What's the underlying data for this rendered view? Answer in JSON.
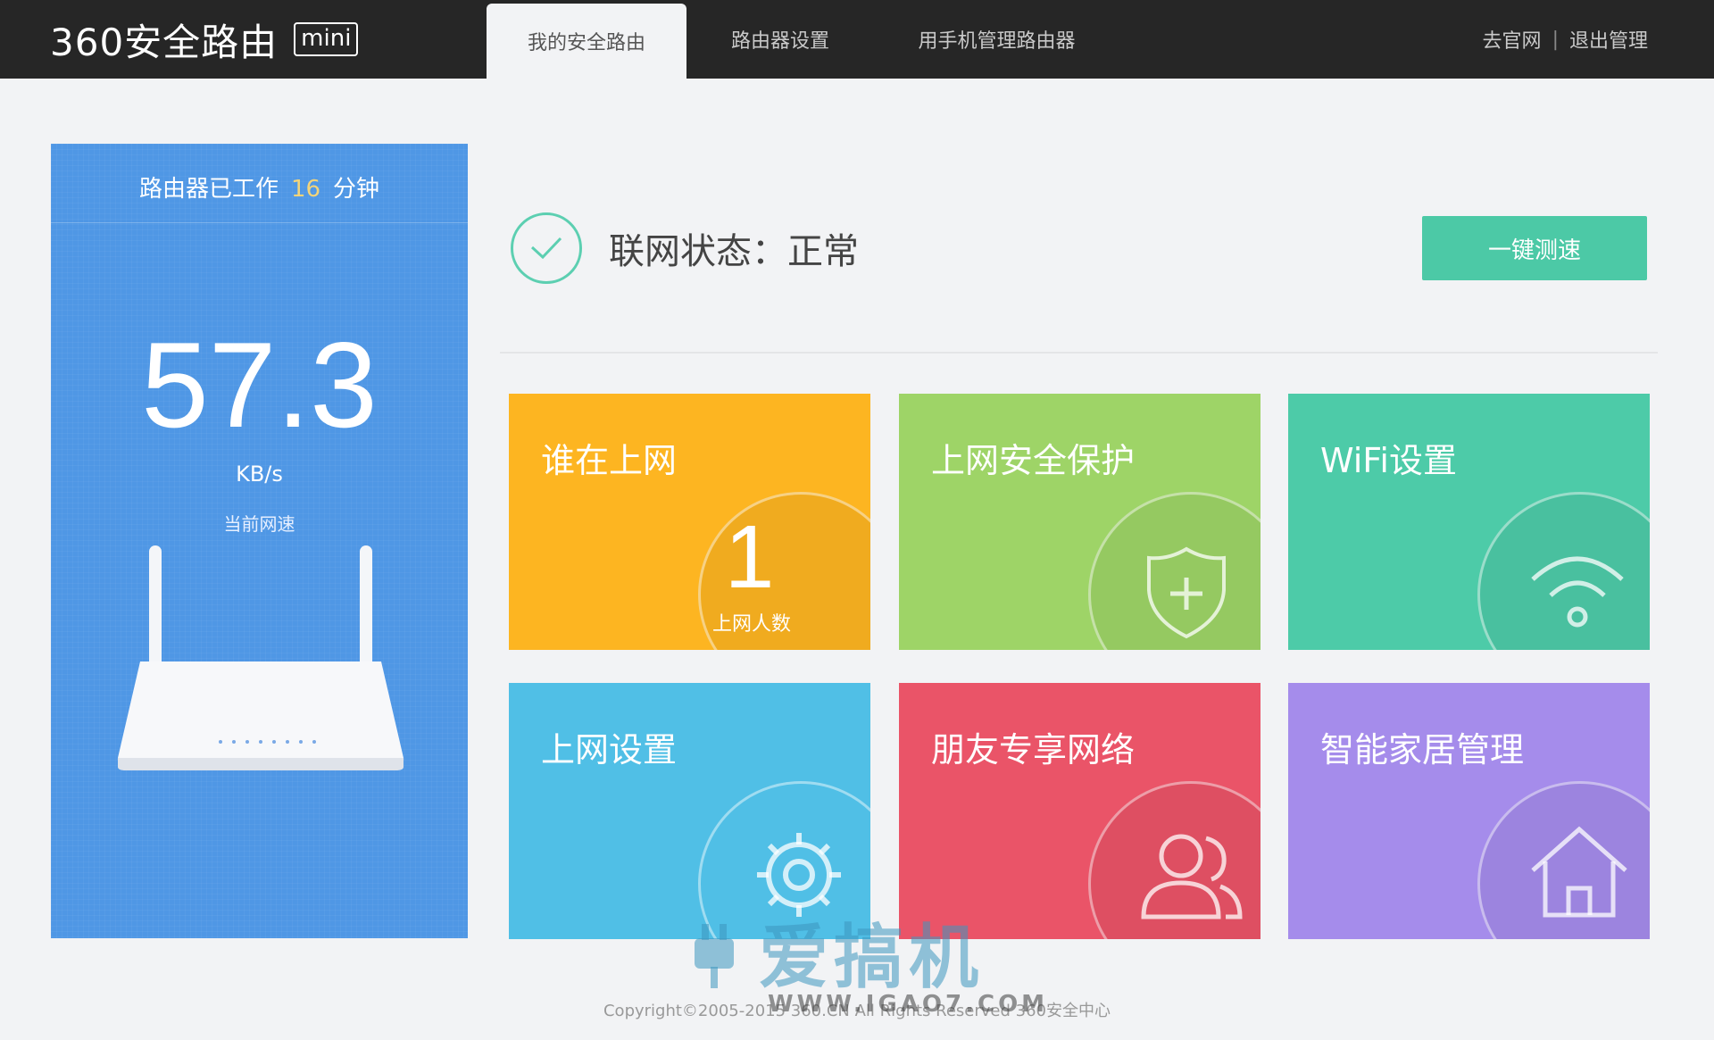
{
  "header": {
    "logo_text": "360安全路由",
    "logo_badge": "mini",
    "tabs": [
      {
        "label": "我的安全路由",
        "active": true
      },
      {
        "label": "路由器设置",
        "active": false
      },
      {
        "label": "用手机管理路由器",
        "active": false
      }
    ],
    "links": {
      "official_site": "去官网",
      "separator": "|",
      "logout": "退出管理"
    }
  },
  "speed_panel": {
    "uptime_prefix": "路由器已工作",
    "uptime_minutes": "16",
    "uptime_suffix": "分钟",
    "speed_value": "57.3",
    "speed_unit": "KB/s",
    "speed_label": "当前网速"
  },
  "status": {
    "text": "联网状态：正常",
    "speedtest_button": "一键测速"
  },
  "tiles": [
    {
      "title": "谁在上网",
      "color": "#fdb521",
      "count": "1",
      "count_label": "上网人数"
    },
    {
      "title": "上网安全保护",
      "color": "#9ed467",
      "icon": "shield-plus-icon"
    },
    {
      "title": "WiFi设置",
      "color": "#4dcba8",
      "icon": "wifi-icon"
    },
    {
      "title": "上网设置",
      "color": "#50bfe6",
      "icon": "gear-icon"
    },
    {
      "title": "朋友专享网络",
      "color": "#ea5468",
      "icon": "users-icon"
    },
    {
      "title": "智能家居管理",
      "color": "#a58ceb",
      "icon": "house-icon"
    }
  ],
  "footer": {
    "copyright": "Copyright©2005-2015 360.CN All Rights Reserved 360安全中心",
    "watermark": "爱搞机",
    "watermark_url": "WWW.IGAO7.COM"
  },
  "colors": {
    "topbar": "#262626",
    "speed_panel": "#4f97e5",
    "accent_green": "#4cc9a6"
  }
}
